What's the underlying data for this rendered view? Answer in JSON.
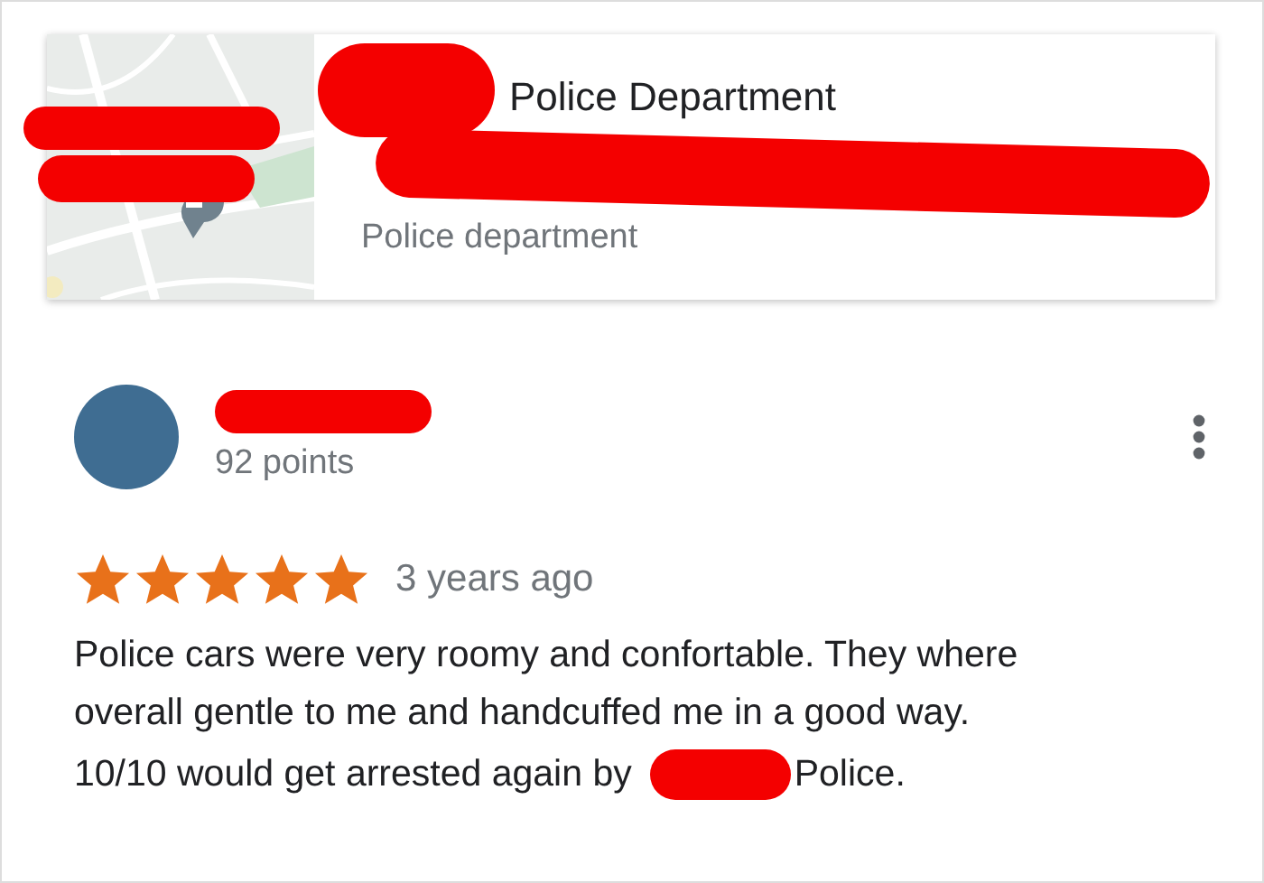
{
  "place": {
    "kind": "picture",
    "title": "Police Department",
    "category": "Police department"
  },
  "review": {
    "points": "92 points",
    "stars": 5,
    "time": "3 years ago",
    "lines": [
      "Police cars were very roomy and confortable. They where",
      "overall gentle to me and handcuffed me in a good way."
    ],
    "last_line": {
      "before": "10/10 would get arrested again by",
      "after": "Police."
    }
  }
}
